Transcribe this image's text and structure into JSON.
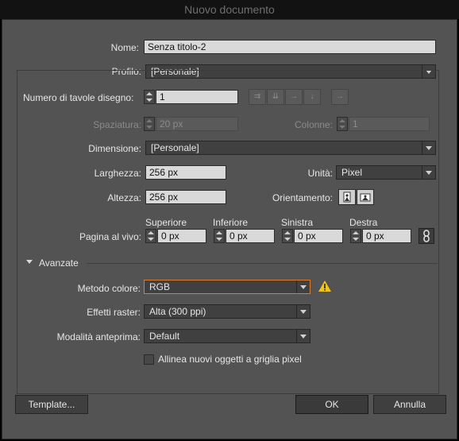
{
  "window": {
    "title": "Nuovo documento"
  },
  "name": {
    "label": "Nome:",
    "value": "Senza titolo-2"
  },
  "profile": {
    "label": "Profilo:",
    "value": "[Personale]"
  },
  "artboards": {
    "count_label": "Numero di tavole disegno:",
    "count_value": "1",
    "spacing_label": "Spaziatura:",
    "spacing_value": "20 px",
    "columns_label": "Colonne:",
    "columns_value": "1"
  },
  "size": {
    "label": "Dimensione:",
    "value": "[Personale]"
  },
  "width": {
    "label": "Larghezza:",
    "value": "256 px"
  },
  "units": {
    "label": "Unità:",
    "value": "Pixel"
  },
  "height": {
    "label": "Altezza:",
    "value": "256 px"
  },
  "orientation": {
    "label": "Orientamento:"
  },
  "bleed": {
    "label": "Pagina al vivo:",
    "top_label": "Superiore",
    "top_value": "0 px",
    "bottom_label": "Inferiore",
    "bottom_value": "0 px",
    "left_label": "Sinistra",
    "left_value": "0 px",
    "right_label": "Destra",
    "right_value": "0 px"
  },
  "advanced": {
    "label": "Avanzate",
    "color_mode_label": "Metodo colore:",
    "color_mode_value": "RGB",
    "raster_label": "Effetti raster:",
    "raster_value": "Alta (300 ppi)",
    "preview_label": "Modalità anteprima:",
    "preview_value": "Default",
    "align_label": "Allinea nuovi oggetti a griglia pixel"
  },
  "buttons": {
    "template": "Template...",
    "ok": "OK",
    "cancel": "Annulla"
  },
  "colors": {
    "warning": "#f0c419",
    "focus_border": "#e07b2a"
  }
}
